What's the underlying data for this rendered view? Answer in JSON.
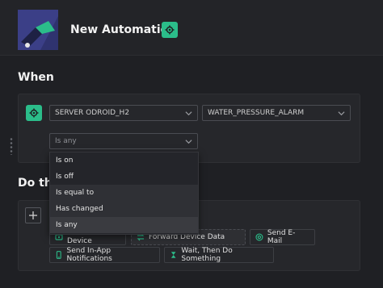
{
  "header": {
    "title": "New Automation",
    "settings_icon": "gear-icon"
  },
  "when": {
    "title": "When",
    "server_select": "SERVER ODROID_H2",
    "event_select": "WATER_PRESSURE_ALARM",
    "state_select": "Is any",
    "dropdown_options": [
      "Is on",
      "Is off",
      "Is equal to",
      "Has changed",
      "Is any"
    ],
    "selected_option": "Is any"
  },
  "do": {
    "title": "Do this",
    "add_icon": "plus-icon",
    "actions": [
      {
        "label": "Control Device",
        "icon": "device-control-icon"
      },
      {
        "label": "Forward Device Data",
        "icon": "forward-arrows-icon"
      },
      {
        "label": "Send E-Mail",
        "icon": "at-sign-icon"
      },
      {
        "label": "Send In-App Notifications",
        "icon": "phone-icon"
      },
      {
        "label": "Wait, Then Do Something",
        "icon": "hourglass-icon"
      }
    ]
  },
  "colors": {
    "accent": "#2bbd8a",
    "background": "#1f2024",
    "panel": "#26272b",
    "thumbnail": "#3b3f87"
  }
}
